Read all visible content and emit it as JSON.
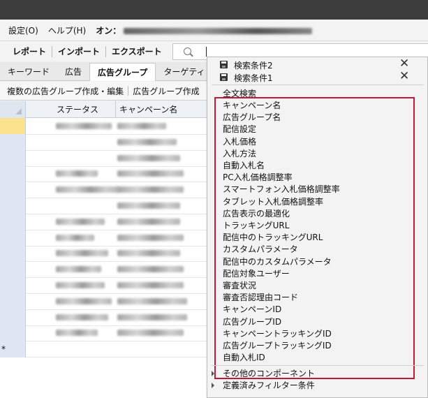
{
  "menubar": {
    "items": [
      "設定(O)",
      "ヘルプ(H)"
    ],
    "account_prefix": "オン："
  },
  "toolbar": {
    "buttons": [
      "レポート",
      "インポート",
      "エクスポート"
    ]
  },
  "tabs": [
    "キーワード",
    "広告",
    "広告グループ",
    "ターゲティ"
  ],
  "active_tab": "広告グループ",
  "subtoolbar": {
    "actions": [
      "複数の広告グループ作成・編集",
      "広告グループ作成"
    ]
  },
  "grid": {
    "columns": [
      "ステータス",
      "キャンペーン名"
    ],
    "new_row_marker": "*"
  },
  "search_dropdown": {
    "saved_conditions": [
      "検索条件2",
      "検索条件1"
    ],
    "fulltext_option": "全文検索",
    "field_options": [
      "キャンペーン名",
      "広告グループ名",
      "配信設定",
      "入札価格",
      "入札方法",
      "自動入札名",
      "PC入札価格調整率",
      "スマートフォン入札価格調整率",
      "タブレット入札価格調整率",
      "広告表示の最適化",
      "トラッキングURL",
      "配信中のトラッキングURL",
      "カスタムパラメータ",
      "配信中のカスタムパラメータ",
      "配信対象ユーザー",
      "審査状況",
      "審査否認理由コード",
      "キャンペーンID",
      "広告グループID",
      "キャンペーントラッキングID",
      "広告グループトラッキングID",
      "自動入札ID"
    ],
    "submenus": [
      "その他のコンポーネント",
      "定義済みフィルター条件"
    ],
    "highlight_color": "#c0193a"
  },
  "icons": [
    "save-icon",
    "close-icon",
    "search-icon",
    "submenu-arrow-icon"
  ]
}
